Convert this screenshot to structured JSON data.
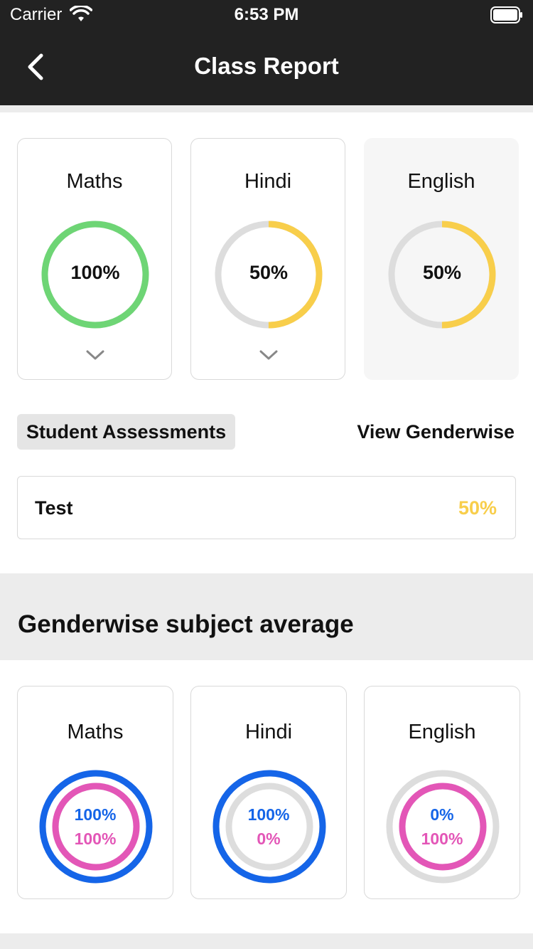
{
  "status_bar": {
    "carrier": "Carrier",
    "time": "6:53 PM"
  },
  "nav": {
    "title": "Class Report"
  },
  "subjects": [
    {
      "name": "Maths",
      "percent_label": "100%",
      "progress": 1.0,
      "ring_color": "#6ed575",
      "selected": false
    },
    {
      "name": "Hindi",
      "percent_label": "50%",
      "progress": 0.5,
      "ring_color": "#f8ce4b",
      "selected": false
    },
    {
      "name": "English",
      "percent_label": "50%",
      "progress": 0.5,
      "ring_color": "#f8ce4b",
      "selected": true
    }
  ],
  "assessments": {
    "tab_label": "Student Assessments",
    "view_genderwise_label": "View Genderwise",
    "items": [
      {
        "name": "Test",
        "value": "50%"
      }
    ]
  },
  "genderwise": {
    "title": "Genderwise subject average",
    "subjects": [
      {
        "name": "Maths",
        "boys_label": "100%",
        "girls_label": "100%",
        "boys_progress": 1.0,
        "girls_progress": 1.0
      },
      {
        "name": "Hindi",
        "boys_label": "100%",
        "girls_label": "0%",
        "boys_progress": 1.0,
        "girls_progress": 0.0
      },
      {
        "name": "English",
        "boys_label": "0%",
        "girls_label": "100%",
        "boys_progress": 0.0,
        "girls_progress": 1.0
      }
    ]
  },
  "colors": {
    "bar_bg": "#222222",
    "ring_track": "#dddddd",
    "green": "#6ed575",
    "yellow": "#f8ce4b",
    "blue": "#1565e8",
    "pink": "#e356b7"
  }
}
